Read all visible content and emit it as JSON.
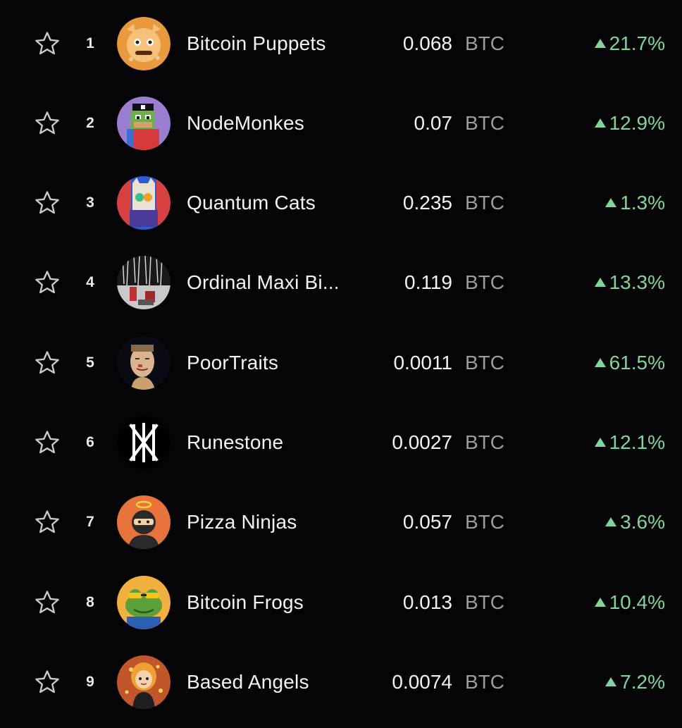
{
  "theme": {
    "background": "#050507",
    "positive_color": "#7fd69a",
    "unit_color": "#9c9ca3",
    "star_color": "#c9c9c9"
  },
  "collections": [
    {
      "rank": "1",
      "name": "Bitcoin Puppets",
      "price": "0.068",
      "unit": "BTC",
      "change": "21.7%",
      "trend": "up",
      "avatar_icon": "puppet-avatar-icon",
      "avatar_color": "#e89a3c"
    },
    {
      "rank": "2",
      "name": "NodeMonkes",
      "price": "0.07",
      "unit": "BTC",
      "change": "12.9%",
      "trend": "up",
      "avatar_icon": "pixel-monkey-avatar-icon",
      "avatar_color": "#9a7fd0"
    },
    {
      "rank": "3",
      "name": "Quantum Cats",
      "price": "0.235",
      "unit": "BTC",
      "change": "1.3%",
      "trend": "up",
      "avatar_icon": "quantum-cat-avatar-icon",
      "avatar_color": "#2c5bd6"
    },
    {
      "rank": "4",
      "name": "Ordinal Maxi Bi...",
      "price": "0.119",
      "unit": "BTC",
      "change": "13.3%",
      "trend": "up",
      "avatar_icon": "ordinal-maxi-avatar-icon",
      "avatar_color": "#c8c8c8"
    },
    {
      "rank": "5",
      "name": "PoorTraits",
      "price": "0.0011",
      "unit": "BTC",
      "change": "61.5%",
      "trend": "up",
      "avatar_icon": "portrait-avatar-icon",
      "avatar_color": "#0a0a14"
    },
    {
      "rank": "6",
      "name": "Runestone",
      "price": "0.0027",
      "unit": "BTC",
      "change": "12.1%",
      "trend": "up",
      "avatar_icon": "runestone-avatar-icon",
      "avatar_color": "#000000"
    },
    {
      "rank": "7",
      "name": "Pizza Ninjas",
      "price": "0.057",
      "unit": "BTC",
      "change": "3.6%",
      "trend": "up",
      "avatar_icon": "ninja-avatar-icon",
      "avatar_color": "#e8743b"
    },
    {
      "rank": "8",
      "name": "Bitcoin Frogs",
      "price": "0.013",
      "unit": "BTC",
      "change": "10.4%",
      "trend": "up",
      "avatar_icon": "frog-avatar-icon",
      "avatar_color": "#f2b03f"
    },
    {
      "rank": "9",
      "name": "Based Angels",
      "price": "0.0074",
      "unit": "BTC",
      "change": "7.2%",
      "trend": "up",
      "avatar_icon": "angel-avatar-icon",
      "avatar_color": "#c0562a"
    }
  ]
}
